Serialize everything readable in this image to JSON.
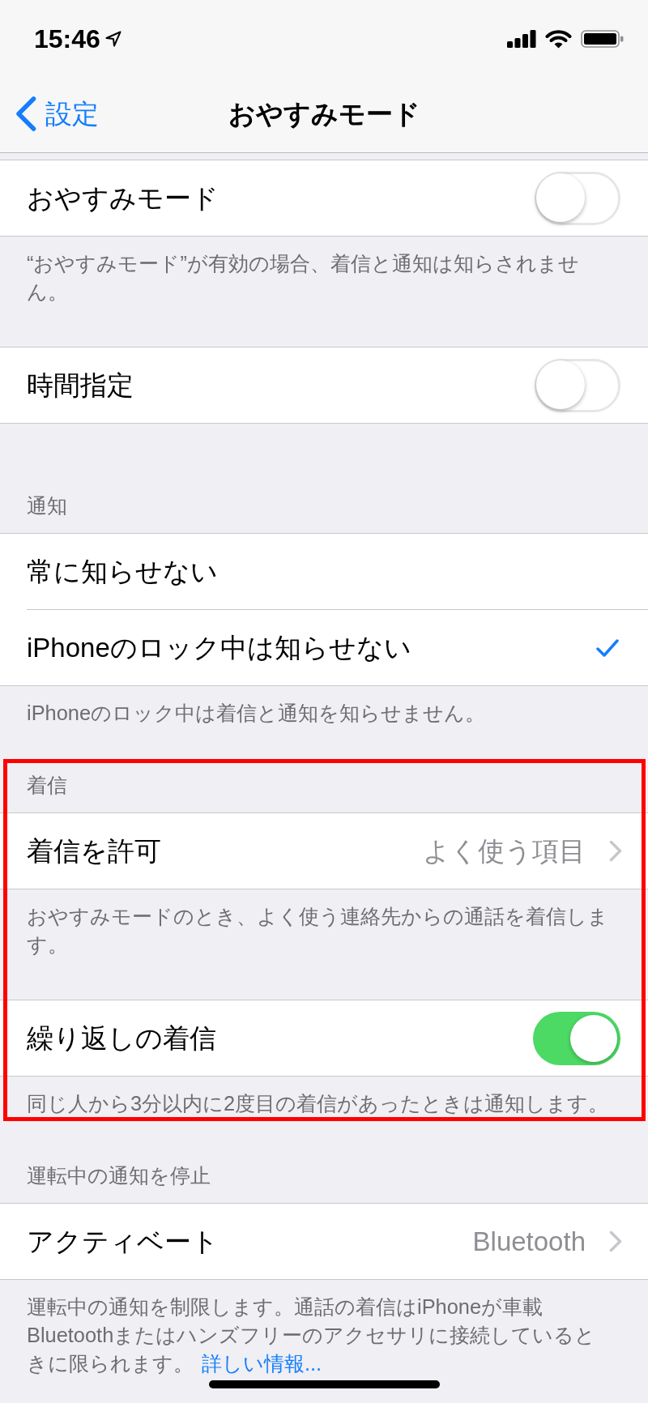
{
  "status_bar": {
    "time": "15:46"
  },
  "nav": {
    "back": "設定",
    "title": "おやすみモード"
  },
  "sections": [
    {
      "highlighted": false,
      "rows": [
        {
          "kind": "toggle",
          "label": "おやすみモード",
          "on": false
        }
      ],
      "footer": {
        "text": "“おやすみモード”が有効の場合、着信と通知は知らされません。"
      }
    },
    {
      "highlighted": false,
      "rows": [
        {
          "kind": "toggle",
          "label": "時間指定",
          "on": false
        }
      ]
    },
    {
      "highlighted": false,
      "header": "通知",
      "rows": [
        {
          "kind": "option",
          "label": "常に知らせない",
          "selected": false
        },
        {
          "kind": "option",
          "label": "iPhoneのロック中は知らせない",
          "selected": true
        }
      ],
      "footer": {
        "text": "iPhoneのロック中は着信と通知を知らせません。"
      }
    },
    {
      "highlighted": true,
      "header": "着信",
      "rows": [
        {
          "kind": "disclosure",
          "label": "着信を許可",
          "value": "よく使う項目"
        }
      ],
      "footer": {
        "text": "おやすみモードのとき、よく使う連絡先からの通話を着信します。"
      }
    },
    {
      "highlighted": true,
      "rows": [
        {
          "kind": "toggle",
          "label": "繰り返しの着信",
          "on": true
        }
      ],
      "footer": {
        "text": "同じ人から3分以内に2度目の着信があったときは通知します。"
      }
    },
    {
      "highlighted": false,
      "header": "運転中の通知を停止",
      "rows": [
        {
          "kind": "disclosure",
          "label": "アクティベート",
          "value": "Bluetooth"
        }
      ],
      "footer": {
        "text": "運転中の通知を制限します。通話の着信はiPhoneが車載Bluetoothまたはハンズフリーのアクセサリに接続しているときに限られます。",
        "link": "詳しい情報..."
      }
    }
  ]
}
